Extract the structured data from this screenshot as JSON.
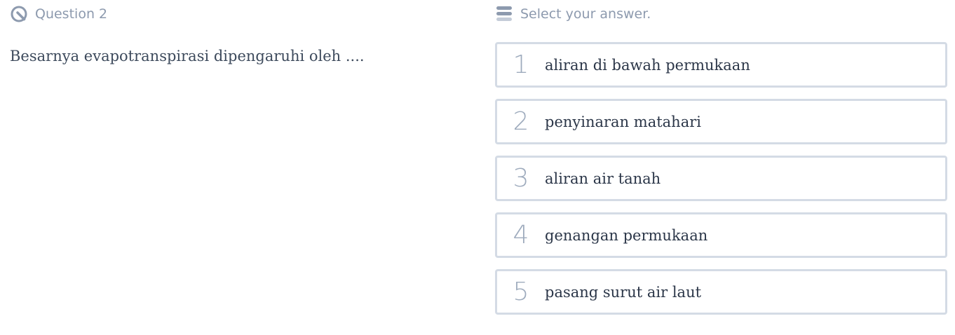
{
  "question": {
    "header_label": "Question 2",
    "text": "Besarnya evapotranspirasi dipengaruhi oleh ....",
    "header_icon": "quiz-pen-icon"
  },
  "answers": {
    "header_label": "Select your answer.",
    "header_icon": "list-icon",
    "options": [
      {
        "number": "1",
        "label": "aliran di bawah permukaan"
      },
      {
        "number": "2",
        "label": "penyinaran matahari"
      },
      {
        "number": "3",
        "label": "aliran air tanah"
      },
      {
        "number": "4",
        "label": "genangan permukaan"
      },
      {
        "number": "5",
        "label": "pasang surut air laut"
      }
    ]
  },
  "colors": {
    "muted_text": "#8d9aae",
    "option_border": "#d4dbe5",
    "option_number": "#9eabbd",
    "body_text": "#3d4a5c"
  }
}
